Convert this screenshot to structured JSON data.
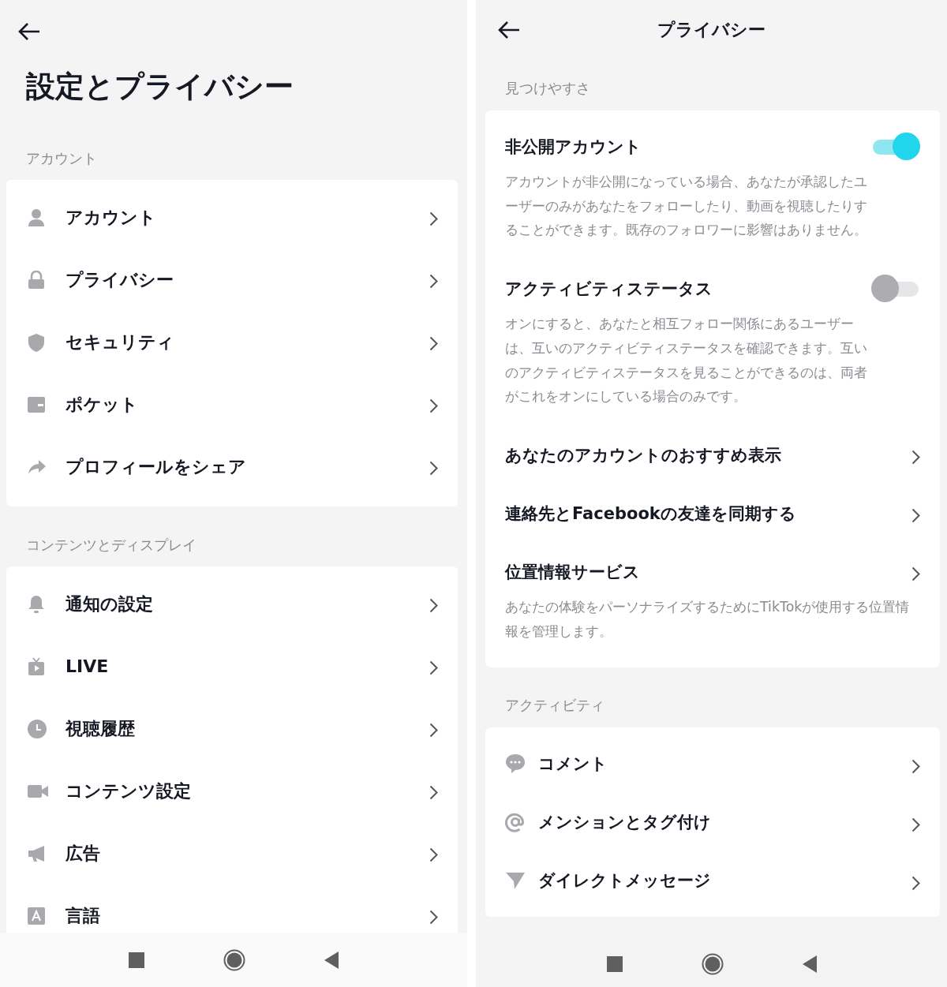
{
  "left": {
    "title": "設定とプライバシー",
    "sections": [
      {
        "heading": "アカウント",
        "items": [
          {
            "label": "アカウント"
          },
          {
            "label": "プライバシー"
          },
          {
            "label": "セキュリティ"
          },
          {
            "label": "ポケット"
          },
          {
            "label": "プロフィールをシェア"
          }
        ]
      },
      {
        "heading": "コンテンツとディスプレイ",
        "items": [
          {
            "label": "通知の設定"
          },
          {
            "label": "LIVE"
          },
          {
            "label": "視聴履歴"
          },
          {
            "label": "コンテンツ設定"
          },
          {
            "label": "広告"
          },
          {
            "label": "言語"
          }
        ]
      }
    ]
  },
  "right": {
    "title": "プライバシー",
    "sections": [
      {
        "heading": "見つけやすさ",
        "items": [
          {
            "kind": "toggle",
            "label": "非公開アカウント",
            "description": "アカウントが非公開になっている場合、あなたが承認したユーザーのみがあなたをフォローしたり、動画を視聴したりすることができます。既存のフォロワーに影響はありません。",
            "on": true
          },
          {
            "kind": "toggle",
            "label": "アクティビティステータス",
            "description": "オンにすると、あなたと相互フォロー関係にあるユーザーは、互いのアクティビティステータスを確認できます。互いのアクティビティステータスを見ることができるのは、両者がこれをオンにしている場合のみです。",
            "on": false
          },
          {
            "kind": "link",
            "label": "あなたのアカウントのおすすめ表示"
          },
          {
            "kind": "link",
            "label": "連絡先とFacebookの友達を同期する"
          },
          {
            "kind": "link",
            "label": "位置情報サービス",
            "description": "あなたの体験をパーソナライズするためにTikTokが使用する位置情報を管理します。"
          }
        ]
      },
      {
        "heading": "アクティビティ",
        "items": [
          {
            "kind": "link",
            "label": "コメント"
          },
          {
            "kind": "link",
            "label": "メンションとタグ付け"
          },
          {
            "kind": "link",
            "label": "ダイレクトメッセージ"
          }
        ]
      }
    ]
  }
}
